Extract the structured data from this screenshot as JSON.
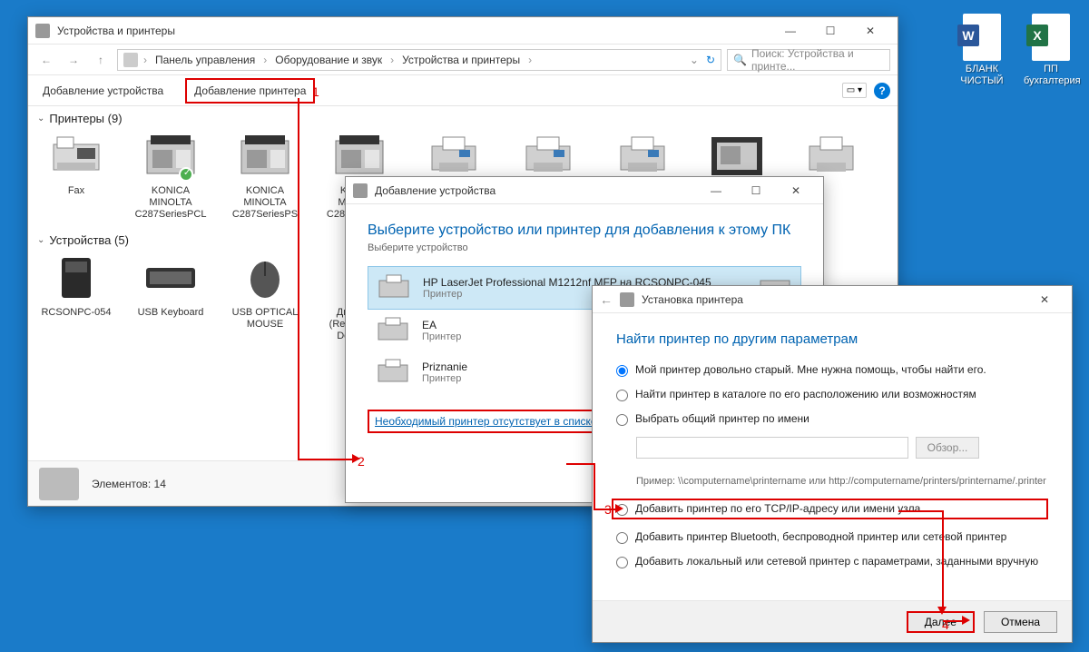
{
  "desktop": {
    "icon1": "БЛАНК ЧИСТЫЙ",
    "icon2": "ПП бухгалтерия"
  },
  "main": {
    "title": "Устройства и принтеры",
    "breadcrumb": {
      "bc1": "Панель управления",
      "bc2": "Оборудование и звук",
      "bc3": "Устройства и принтеры"
    },
    "search_placeholder": "Поиск: Устройства и принте...",
    "toolbar": {
      "add_device": "Добавление устройства",
      "add_printer": "Добавление принтера"
    },
    "printers_header": "Принтеры (9)",
    "devices_header": "Устройства (5)",
    "printers": {
      "p1": "Fax",
      "p2": "KONICA MINOLTA C287SeriesPCL",
      "p3": "KONICA MINOLTA C287SeriesPS",
      "p4": "KONICA MINOLTA C287SeriesPS"
    },
    "devices": {
      "d1": "RCSONPC-054",
      "d2": "USB Keyboard",
      "d3": "USB OPTICAL MOUSE",
      "d4": "Динамики (Realtek High Definition)"
    },
    "status": "Элементов: 14"
  },
  "dialog1": {
    "win_title": "Добавление устройства",
    "title": "Выберите устройство или принтер для добавления к этому ПК",
    "subtitle": "Выберите устройство",
    "items": {
      "i1_name": "HP LaserJet Professional M1212nf MFP на RCSONPC-045",
      "i1_type": "Принтер",
      "i2_name": "EA",
      "i2_type": "Принтер",
      "i3_name": "Priznanie",
      "i3_type": "Принтер"
    },
    "link": "Необходимый принтер отсутствует в списке"
  },
  "dialog2": {
    "win_title": "Установка принтера",
    "heading": "Найти принтер по другим параметрам",
    "opt1": "Мой принтер довольно старый. Мне нужна помощь, чтобы найти его.",
    "opt2": "Найти принтер в каталоге по его расположению или возможностям",
    "opt3": "Выбрать общий принтер по имени",
    "browse": "Обзор...",
    "example": "Пример: \\\\computername\\printername или http://computername/printers/printername/.printer",
    "opt4": "Добавить принтер по его TCP/IP-адресу или имени узла",
    "opt5": "Добавить принтер Bluetooth, беспроводной принтер или сетевой принтер",
    "opt6": "Добавить локальный или сетевой принтер с параметрами, заданными вручную",
    "next": "Далее",
    "cancel": "Отмена"
  },
  "steps": {
    "s1": "1",
    "s2": "2",
    "s3": "3",
    "s4": "4"
  }
}
